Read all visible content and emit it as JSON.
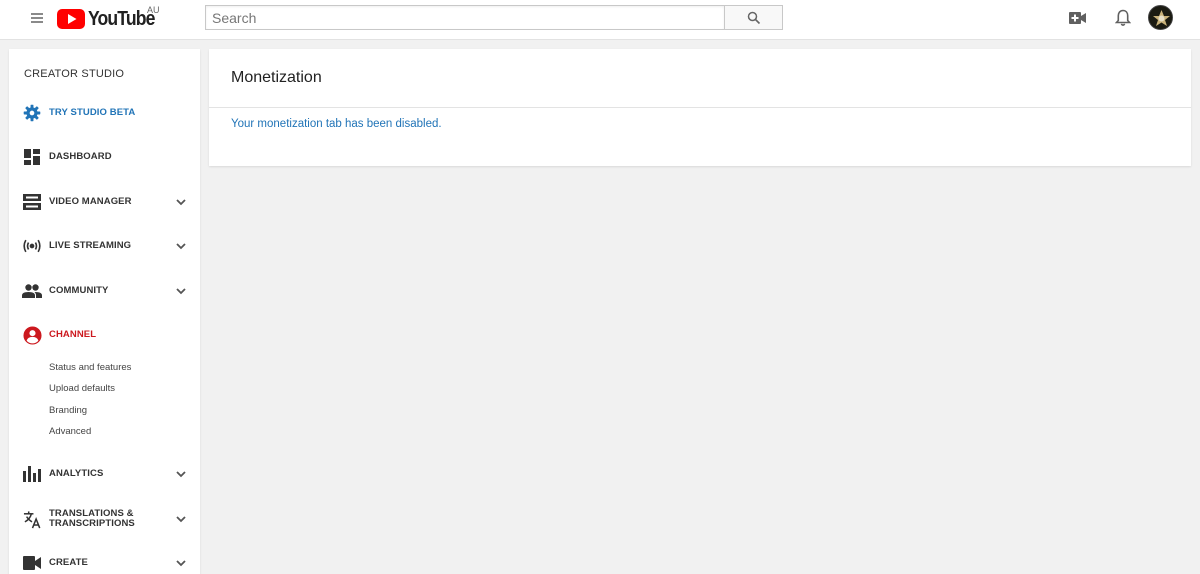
{
  "header": {
    "logo_text": "YouTube",
    "region": "AU",
    "search_placeholder": "Search",
    "search_value": "",
    "brand_color": "#ff0000"
  },
  "sidebar": {
    "title": "CREATOR STUDIO",
    "items": [
      {
        "label": "TRY STUDIO BETA",
        "icon": "gear-icon",
        "color": "#2174b7",
        "expandable": false
      },
      {
        "label": "DASHBOARD",
        "icon": "dashboard-icon",
        "expandable": false
      },
      {
        "label": "VIDEO MANAGER",
        "icon": "video-manager-icon",
        "expandable": true
      },
      {
        "label": "LIVE STREAMING",
        "icon": "live-streaming-icon",
        "expandable": true
      },
      {
        "label": "COMMUNITY",
        "icon": "community-icon",
        "expandable": true
      },
      {
        "label": "CHANNEL",
        "icon": "account-circle-icon",
        "color": "#cc181e",
        "expandable": false,
        "active": true
      },
      {
        "label": "ANALYTICS",
        "icon": "analytics-icon",
        "expandable": true
      },
      {
        "label": "TRANSLATIONS &",
        "label2": "TRANSCRIPTIONS",
        "icon": "translate-icon",
        "expandable": true
      },
      {
        "label": "CREATE",
        "icon": "videocam-icon",
        "expandable": true
      }
    ],
    "channel_subitems": [
      "Status and features",
      "Upload defaults",
      "Branding",
      "Advanced"
    ]
  },
  "main": {
    "title": "Monetization",
    "message": "Your monetization tab has been disabled.",
    "message_color": "#2174b7"
  }
}
